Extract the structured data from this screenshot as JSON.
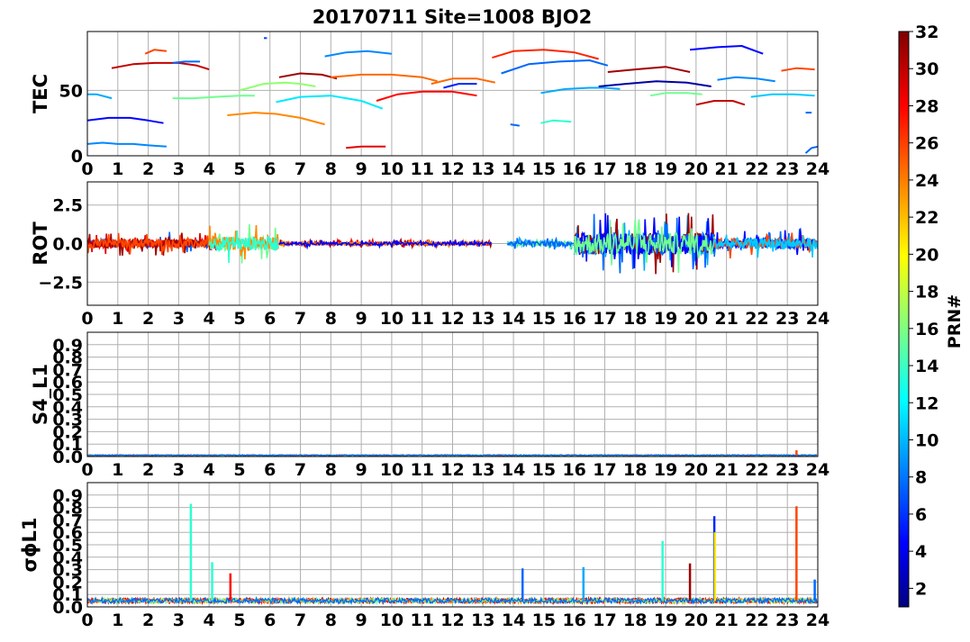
{
  "figure": {
    "title": "20170711 Site=1008 BJO2"
  },
  "colorbar": {
    "label": "PRN#",
    "ticks": [
      "2",
      "4",
      "6",
      "8",
      "10",
      "12",
      "14",
      "16",
      "18",
      "20",
      "22",
      "24",
      "26",
      "28",
      "30",
      "32"
    ],
    "range": [
      1,
      32
    ],
    "colormap": "jet"
  },
  "chart_data": [
    {
      "type": "line",
      "panel": "TEC",
      "ylabel": "TEC",
      "xlim": [
        0,
        24
      ],
      "ylim": [
        0,
        95
      ],
      "yticks": [
        "0",
        "50"
      ],
      "xticks": [
        "0",
        "1",
        "2",
        "3",
        "4",
        "5",
        "6",
        "7",
        "8",
        "9",
        "10",
        "11",
        "12",
        "13",
        "14",
        "15",
        "16",
        "17",
        "18",
        "19",
        "20",
        "21",
        "22",
        "23",
        "24"
      ],
      "grid": true,
      "series": [
        {
          "prn": 9,
          "x": [
            0.0,
            0.5,
            1.0,
            1.5,
            2.0,
            2.6
          ],
          "y": [
            9,
            10,
            9,
            9,
            8,
            7
          ]
        },
        {
          "prn": 5,
          "x": [
            0.0,
            0.7,
            1.4,
            2.0,
            2.5
          ],
          "y": [
            27,
            29,
            29,
            27,
            25
          ]
        },
        {
          "prn": 10,
          "x": [
            0.0,
            0.3,
            0.8
          ],
          "y": [
            47,
            47,
            44
          ]
        },
        {
          "prn": 30,
          "x": [
            0.8,
            1.5,
            2.2,
            3.0,
            3.6,
            4.0
          ],
          "y": [
            67,
            70,
            71,
            71,
            69,
            66
          ]
        },
        {
          "prn": 26,
          "x": [
            1.9,
            2.2,
            2.6
          ],
          "y": [
            78,
            81,
            80
          ]
        },
        {
          "prn": 8,
          "x": [
            2.8,
            3.2,
            3.7
          ],
          "y": [
            71,
            72,
            72
          ]
        },
        {
          "prn": 16,
          "x": [
            2.8,
            3.5,
            4.2,
            5.0,
            5.5
          ],
          "y": [
            44,
            44,
            45,
            46,
            46
          ]
        },
        {
          "prn": 7,
          "x": [
            5.8,
            5.9
          ],
          "y": [
            90,
            90
          ]
        },
        {
          "prn": 17,
          "x": [
            5.0,
            5.8,
            6.5,
            7.0,
            7.5
          ],
          "y": [
            50,
            55,
            56,
            55,
            53
          ]
        },
        {
          "prn": 24,
          "x": [
            4.6,
            5.5,
            6.2,
            7.0,
            7.8
          ],
          "y": [
            31,
            33,
            32,
            29,
            24
          ]
        },
        {
          "prn": 12,
          "x": [
            6.2,
            7.0,
            8.0,
            9.0,
            9.7
          ],
          "y": [
            41,
            45,
            46,
            42,
            36
          ]
        },
        {
          "prn": 31,
          "x": [
            6.3,
            7.0,
            7.7,
            8.2
          ],
          "y": [
            60,
            63,
            62,
            59
          ]
        },
        {
          "prn": 9,
          "x": [
            7.8,
            8.5,
            9.2,
            10.0
          ],
          "y": [
            76,
            79,
            80,
            78
          ]
        },
        {
          "prn": 25,
          "x": [
            8.0,
            9.0,
            10.0,
            11.0,
            11.5
          ],
          "y": [
            60,
            62,
            62,
            60,
            57
          ]
        },
        {
          "prn": 29,
          "x": [
            8.5,
            9.0,
            9.8
          ],
          "y": [
            6,
            7,
            7
          ]
        },
        {
          "prn": 28,
          "x": [
            9.5,
            10.2,
            11.0,
            12.0,
            12.8
          ],
          "y": [
            42,
            47,
            49,
            49,
            46
          ]
        },
        {
          "prn": 25,
          "x": [
            11.3,
            12.0,
            12.8,
            13.4
          ],
          "y": [
            55,
            59,
            59,
            56
          ]
        },
        {
          "prn": 6,
          "x": [
            11.7,
            12.2,
            12.8
          ],
          "y": [
            52,
            55,
            55
          ]
        },
        {
          "prn": 27,
          "x": [
            13.3,
            14.0,
            15.0,
            16.0,
            16.8
          ],
          "y": [
            75,
            80,
            81,
            79,
            74
          ]
        },
        {
          "prn": 8,
          "x": [
            13.6,
            14.5,
            15.5,
            16.5,
            17.1
          ],
          "y": [
            63,
            70,
            72,
            73,
            69
          ]
        },
        {
          "prn": 8,
          "x": [
            13.9,
            14.2
          ],
          "y": [
            24,
            23
          ]
        },
        {
          "prn": 14,
          "x": [
            14.9,
            15.3,
            15.9
          ],
          "y": [
            25,
            27,
            26
          ]
        },
        {
          "prn": 10,
          "x": [
            14.9,
            15.7,
            16.5,
            17.0,
            17.5
          ],
          "y": [
            48,
            51,
            52,
            52,
            51
          ]
        },
        {
          "prn": 2,
          "x": [
            16.8,
            17.7,
            18.7,
            19.7,
            20.5
          ],
          "y": [
            53,
            55,
            57,
            56,
            53
          ]
        },
        {
          "prn": 31,
          "x": [
            17.1,
            18.0,
            19.0,
            19.8
          ],
          "y": [
            64,
            66,
            68,
            64
          ]
        },
        {
          "prn": 16,
          "x": [
            18.5,
            19.0,
            19.7,
            20.2
          ],
          "y": [
            46,
            48,
            48,
            47
          ]
        },
        {
          "prn": 5,
          "x": [
            19.8,
            20.7,
            21.5,
            22.2
          ],
          "y": [
            81,
            83,
            84,
            78
          ]
        },
        {
          "prn": 30,
          "x": [
            20.0,
            20.6,
            21.2,
            21.6
          ],
          "y": [
            39,
            42,
            42,
            39
          ]
        },
        {
          "prn": 9,
          "x": [
            20.7,
            21.3,
            22.0,
            22.6
          ],
          "y": [
            58,
            60,
            59,
            57
          ]
        },
        {
          "prn": 11,
          "x": [
            21.8,
            22.5,
            23.2,
            23.9
          ],
          "y": [
            45,
            47,
            47,
            46
          ]
        },
        {
          "prn": 26,
          "x": [
            22.8,
            23.3,
            23.9
          ],
          "y": [
            65,
            67,
            66
          ]
        },
        {
          "prn": 8,
          "x": [
            23.6,
            23.8
          ],
          "y": [
            33,
            33
          ]
        },
        {
          "prn": 8,
          "x": [
            23.6,
            23.8,
            24.0
          ],
          "y": [
            2,
            6,
            7
          ]
        }
      ]
    },
    {
      "type": "line",
      "panel": "ROT",
      "ylabel": "ROT",
      "xlim": [
        0,
        24
      ],
      "ylim": [
        -4,
        4
      ],
      "yticks": [
        "2.5",
        "0.0",
        "−2.5"
      ],
      "ytick_values": [
        2.5,
        0.0,
        -2.5
      ],
      "xticks": [
        "0",
        "1",
        "2",
        "3",
        "4",
        "5",
        "6",
        "7",
        "8",
        "9",
        "10",
        "11",
        "12",
        "13",
        "14",
        "15",
        "16",
        "17",
        "18",
        "19",
        "20",
        "21",
        "22",
        "23",
        "24"
      ],
      "grid": true,
      "activity": [
        {
          "x0": 0.0,
          "x1": 4.3,
          "amp": 0.8,
          "prns": [
            8,
            29,
            31,
            26
          ]
        },
        {
          "x0": 4.0,
          "x1": 6.3,
          "amp": 1.3,
          "prns": [
            16,
            24,
            14
          ]
        },
        {
          "x0": 6.3,
          "x1": 13.3,
          "amp": 0.25,
          "prns": [
            31,
            29,
            24,
            5
          ]
        },
        {
          "x0": 13.8,
          "x1": 16.0,
          "amp": 0.4,
          "prns": [
            10,
            16,
            8
          ]
        },
        {
          "x0": 16.0,
          "x1": 20.6,
          "amp": 2.0,
          "prns": [
            10,
            31,
            8,
            5,
            16
          ]
        },
        {
          "x0": 20.6,
          "x1": 24.0,
          "amp": 1.0,
          "prns": [
            8,
            5,
            26,
            11
          ]
        }
      ]
    },
    {
      "type": "line",
      "panel": "S4_L1",
      "ylabel": "S4_L1",
      "xlim": [
        0,
        24
      ],
      "ylim": [
        0,
        1
      ],
      "yticks": [
        "0.0",
        "0.1",
        "0.2",
        "0.3",
        "0.4",
        "0.5",
        "0.6",
        "0.7",
        "0.8",
        "0.9"
      ],
      "ytick_values": [
        0.0,
        0.1,
        0.2,
        0.3,
        0.4,
        0.5,
        0.6,
        0.7,
        0.8,
        0.9
      ],
      "xticks": [
        "0",
        "1",
        "2",
        "3",
        "4",
        "5",
        "6",
        "7",
        "8",
        "9",
        "10",
        "11",
        "12",
        "13",
        "14",
        "15",
        "16",
        "17",
        "18",
        "19",
        "20",
        "21",
        "22",
        "23",
        "24"
      ],
      "grid": true,
      "baseline": 0.01,
      "spikes": [
        {
          "x": 23.3,
          "y": 0.05,
          "prn": 26
        }
      ]
    },
    {
      "type": "line",
      "panel": "sigma_phi",
      "ylabel": "σϕL1",
      "xlim": [
        0,
        24
      ],
      "ylim": [
        0,
        1
      ],
      "yticks": [
        "0.0",
        "0.1",
        "0.2",
        "0.3",
        "0.4",
        "0.5",
        "0.6",
        "0.7",
        "0.8",
        "0.9"
      ],
      "ytick_values": [
        0.0,
        0.1,
        0.2,
        0.3,
        0.4,
        0.5,
        0.6,
        0.7,
        0.8,
        0.9
      ],
      "xticks": [
        "0",
        "1",
        "2",
        "3",
        "4",
        "5",
        "6",
        "7",
        "8",
        "9",
        "10",
        "11",
        "12",
        "13",
        "14",
        "15",
        "16",
        "17",
        "18",
        "19",
        "20",
        "21",
        "22",
        "23",
        "24"
      ],
      "grid": true,
      "baseline": 0.05,
      "spikes": [
        {
          "x": 3.4,
          "y": 0.83,
          "prn": 14
        },
        {
          "x": 4.1,
          "y": 0.36,
          "prn": 14
        },
        {
          "x": 4.7,
          "y": 0.27,
          "prn": 28
        },
        {
          "x": 14.3,
          "y": 0.31,
          "prn": 8
        },
        {
          "x": 16.3,
          "y": 0.32,
          "prn": 10
        },
        {
          "x": 18.9,
          "y": 0.53,
          "prn": 14
        },
        {
          "x": 19.8,
          "y": 0.35,
          "prn": 31
        },
        {
          "x": 20.6,
          "y": 0.73,
          "prn": 6
        },
        {
          "x": 20.62,
          "y": 0.6,
          "prn": 21
        },
        {
          "x": 23.3,
          "y": 0.81,
          "prn": 26
        },
        {
          "x": 23.9,
          "y": 0.22,
          "prn": 8
        }
      ]
    }
  ]
}
